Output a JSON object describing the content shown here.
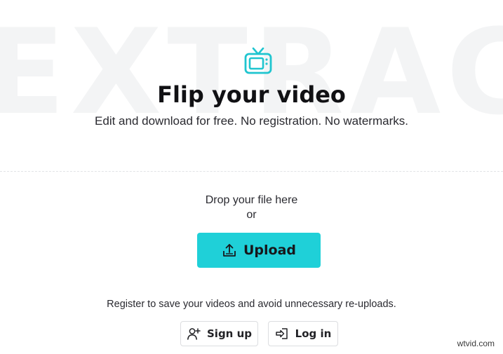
{
  "background_word": "EXTRACT",
  "hero": {
    "icon": "tv-icon",
    "title": "Flip your video",
    "subtitle": "Edit and download for free. No registration. No watermarks."
  },
  "dropzone": {
    "drop_text": "Drop your file here",
    "or_text": "or",
    "upload_label": "Upload",
    "upload_icon": "upload-icon"
  },
  "register": {
    "text": "Register to save your videos and avoid unnecessary re-uploads.",
    "signup_label": "Sign up",
    "signup_icon": "user-plus-icon",
    "login_label": "Log in",
    "login_icon": "login-icon"
  },
  "watermark": "wtvid.com",
  "colors": {
    "accent": "#1fd0d8",
    "background_word": "#f3f4f5",
    "text": "#111114"
  }
}
